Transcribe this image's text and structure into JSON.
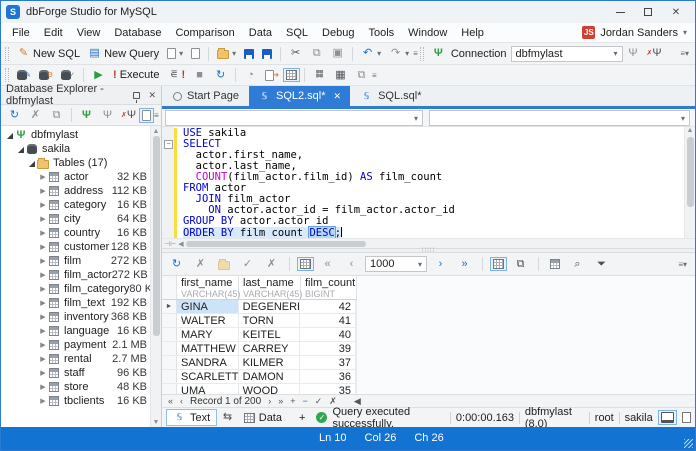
{
  "window": {
    "title": "dbForge Studio for MySQL",
    "user_initials": "JS",
    "user_name": "Jordan Sanders"
  },
  "menu": {
    "items": [
      "File",
      "Edit",
      "View",
      "Database",
      "Comparison",
      "Data",
      "SQL",
      "Debug",
      "Tools",
      "Window",
      "Help"
    ]
  },
  "toolbar": {
    "new_sql": "New SQL",
    "new_query": "New Query",
    "execute": "Execute",
    "connection_label": "Connection",
    "connection_value": "dbfmylast"
  },
  "explorer": {
    "title": "Database Explorer - dbfmylast",
    "tree": [
      {
        "label": "dbfmylast",
        "icon": "plug",
        "level": 0,
        "state": "expanded"
      },
      {
        "label": "sakila",
        "icon": "database",
        "level": 1,
        "state": "expanded"
      },
      {
        "label": "Tables (17)",
        "icon": "folder",
        "level": 2,
        "state": "expanded"
      },
      {
        "label": "actor",
        "size": "32 KB",
        "icon": "table",
        "level": 3,
        "state": "collapsed"
      },
      {
        "label": "address",
        "size": "112 KB",
        "icon": "table",
        "level": 3,
        "state": "collapsed"
      },
      {
        "label": "category",
        "size": "16 KB",
        "icon": "table",
        "level": 3,
        "state": "collapsed"
      },
      {
        "label": "city",
        "size": "64 KB",
        "icon": "table",
        "level": 3,
        "state": "collapsed"
      },
      {
        "label": "country",
        "size": "16 KB",
        "icon": "table",
        "level": 3,
        "state": "collapsed"
      },
      {
        "label": "customer",
        "size": "128 KB",
        "icon": "table",
        "level": 3,
        "state": "collapsed"
      },
      {
        "label": "film",
        "size": "272 KB",
        "icon": "table",
        "level": 3,
        "state": "collapsed"
      },
      {
        "label": "film_actor",
        "size": "272 KB",
        "icon": "table",
        "level": 3,
        "state": "collapsed"
      },
      {
        "label": "film_category",
        "size": "80 KB",
        "icon": "table",
        "level": 3,
        "state": "collapsed"
      },
      {
        "label": "film_text",
        "size": "192 KB",
        "icon": "table",
        "level": 3,
        "state": "collapsed"
      },
      {
        "label": "inventory",
        "size": "368 KB",
        "icon": "table",
        "level": 3,
        "state": "collapsed"
      },
      {
        "label": "language",
        "size": "16 KB",
        "icon": "table",
        "level": 3,
        "state": "collapsed"
      },
      {
        "label": "payment",
        "size": "2.1 MB",
        "icon": "table",
        "level": 3,
        "state": "collapsed"
      },
      {
        "label": "rental",
        "size": "2.7 MB",
        "icon": "table",
        "level": 3,
        "state": "collapsed"
      },
      {
        "label": "staff",
        "size": "96 KB",
        "icon": "table",
        "level": 3,
        "state": "collapsed"
      },
      {
        "label": "store",
        "size": "48 KB",
        "icon": "table",
        "level": 3,
        "state": "collapsed"
      },
      {
        "label": "tbclients",
        "size": "16 KB",
        "icon": "table",
        "level": 3,
        "state": "collapsed"
      }
    ]
  },
  "tabs": [
    {
      "label": "Start Page",
      "active": false,
      "closable": false
    },
    {
      "label": "SQL2.sql*",
      "active": true,
      "closable": true
    },
    {
      "label": "SQL.sql*",
      "active": false,
      "closable": false
    }
  ],
  "editor": {
    "lines": [
      [
        {
          "t": "USE",
          "c": "k"
        },
        {
          "t": " sakila",
          "c": "p"
        }
      ],
      [
        {
          "t": "SELECT",
          "c": "k"
        }
      ],
      [
        {
          "t": "  actor.first_name,",
          "c": "p"
        }
      ],
      [
        {
          "t": "  actor.last_name,",
          "c": "p"
        }
      ],
      [
        {
          "t": "  ",
          "c": "p"
        },
        {
          "t": "COUNT",
          "c": "f"
        },
        {
          "t": "(film_actor.film_id) ",
          "c": "p"
        },
        {
          "t": "AS",
          "c": "k"
        },
        {
          "t": " film_count",
          "c": "p"
        }
      ],
      [
        {
          "t": "FROM",
          "c": "k"
        },
        {
          "t": " actor",
          "c": "p"
        }
      ],
      [
        {
          "t": "  ",
          "c": "p"
        },
        {
          "t": "JOIN",
          "c": "k"
        },
        {
          "t": " film_actor",
          "c": "p"
        }
      ],
      [
        {
          "t": "    ",
          "c": "p"
        },
        {
          "t": "ON",
          "c": "k"
        },
        {
          "t": " actor.actor_id = film_actor.actor_id",
          "c": "p"
        }
      ],
      [
        {
          "t": "GROUP BY",
          "c": "k"
        },
        {
          "t": " actor.actor_id",
          "c": "p"
        }
      ],
      [
        {
          "t": "ORDER BY",
          "c": "k"
        },
        {
          "t": " film_count ",
          "c": "p"
        },
        {
          "t": "DESC",
          "c": "k",
          "sel": true
        },
        {
          "t": ";",
          "c": "p"
        }
      ]
    ]
  },
  "results": {
    "page_size": "1000",
    "columns": [
      {
        "name": "first_name",
        "type": "VARCHAR(45)"
      },
      {
        "name": "last_name",
        "type": "VARCHAR(45)"
      },
      {
        "name": "film_count",
        "type": "BIGINT"
      }
    ],
    "rows": [
      [
        "GINA",
        "DEGENERES",
        "42"
      ],
      [
        "WALTER",
        "TORN",
        "41"
      ],
      [
        "MARY",
        "KEITEL",
        "40"
      ],
      [
        "MATTHEW",
        "CARREY",
        "39"
      ],
      [
        "SANDRA",
        "KILMER",
        "37"
      ],
      [
        "SCARLETT",
        "DAMON",
        "36"
      ],
      [
        "UMA",
        "WOOD",
        "35"
      ]
    ],
    "record_status": "Record 1 of 200"
  },
  "doc_tabs": {
    "text": "Text",
    "data": "Data",
    "add": "+"
  },
  "status": {
    "message": "Query executed successfully.",
    "duration": "0:00:00.163",
    "connection": "dbfmylast (8.0)",
    "user": "root",
    "database": "sakila"
  },
  "caret": {
    "line": "Ln 10",
    "col": "Col 26",
    "ch": "Ch 26"
  },
  "colors": {
    "accent": "#2e7cd6",
    "statusbar": "#1273d2",
    "keyword": "#0000cd",
    "function": "#c800c8",
    "success": "#2daa4f",
    "user_badge": "#d23f31",
    "change_bar": "#f6df3c"
  }
}
